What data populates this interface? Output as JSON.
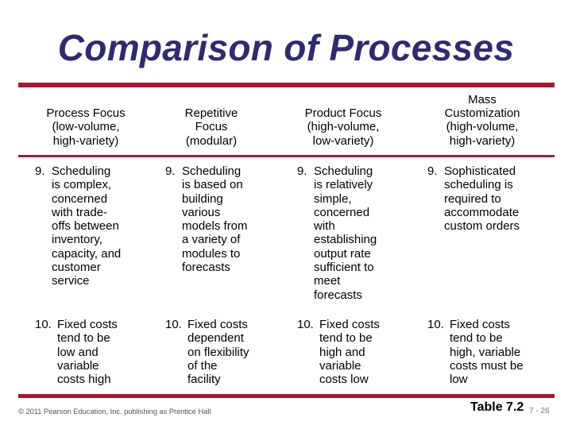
{
  "slide": {
    "title": "Comparison of Processes",
    "accent_color": "#a8172f",
    "title_color": "#2f2b6f"
  },
  "table": {
    "headers": [
      {
        "line1": "Process Focus",
        "line2": "(low-volume,",
        "line3": "high-variety)"
      },
      {
        "line1": "Repetitive",
        "line2": "Focus",
        "line3": "(modular)"
      },
      {
        "line1": "Product Focus",
        "line2": "(high-volume,",
        "line3": "low-variety)"
      },
      {
        "line0": "Mass",
        "line1": "Customization",
        "line2": "(high-volume,",
        "line3": "high-variety)"
      }
    ],
    "rows": [
      {
        "number": "9.",
        "cells": [
          "Scheduling\nis complex,\nconcerned\nwith trade-\noffs between\ninventory,\ncapacity, and\ncustomer\nservice",
          "Scheduling\nis based on\nbuilding\nvarious\nmodels from\na variety of\nmodules to\nforecasts",
          "Scheduling\nis relatively\nsimple,\nconcerned\nwith\nestablishing\noutput rate\nsufficient to\nmeet\nforecasts",
          "Sophisticated\nscheduling is\nrequired to\naccommodate\ncustom orders"
        ]
      },
      {
        "number": "10.",
        "cells": [
          "Fixed costs\ntend to be\nlow and\nvariable\ncosts high",
          "Fixed costs\ndependent\non flexibility\nof the\nfacility",
          "Fixed costs\ntend to be\nhigh and\nvariable\ncosts low",
          "Fixed costs\ntend to be\nhigh, variable\ncosts must be\nlow"
        ]
      }
    ]
  },
  "footer": {
    "copyright": "© 2011 Pearson Education, Inc. publishing as Prentice Hall",
    "table_ref": "Table 7.2",
    "page_number": "7 - 26"
  }
}
